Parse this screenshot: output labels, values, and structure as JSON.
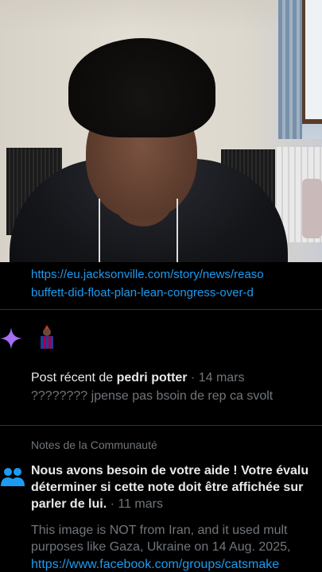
{
  "tweet": {
    "link_line_1": "https://eu.jacksonville.com/story/news/reaso",
    "link_line_2": "buffett-did-float-plan-lean-congress-over-d"
  },
  "recent_post": {
    "prefix": "Post récent de ",
    "author": "pedri potter",
    "separator": " · ",
    "date": "14 mars",
    "text": "???????? jpense pas bsoin de rep ca svolt"
  },
  "community_notes": {
    "header": "Notes de la Communauté",
    "title_line_1": "Nous avons besoin de votre aide ! Votre évalu",
    "title_line_2": "déterminer si cette note doit être affichée sur",
    "title_line_3": "parler de lui.",
    "date": " · 11 mars",
    "body_line_1": "This image is NOT from Iran, and it used mult",
    "body_line_2": "purposes like Gaza, Ukraine on 14 Aug. 2025,",
    "link": "https://www.facebook.com/groups/catsmake"
  },
  "colors": {
    "accent": "#1d9bf0",
    "muted": "#71767b",
    "sparkle": "#a56ef5",
    "people": "#1d9bf0"
  }
}
